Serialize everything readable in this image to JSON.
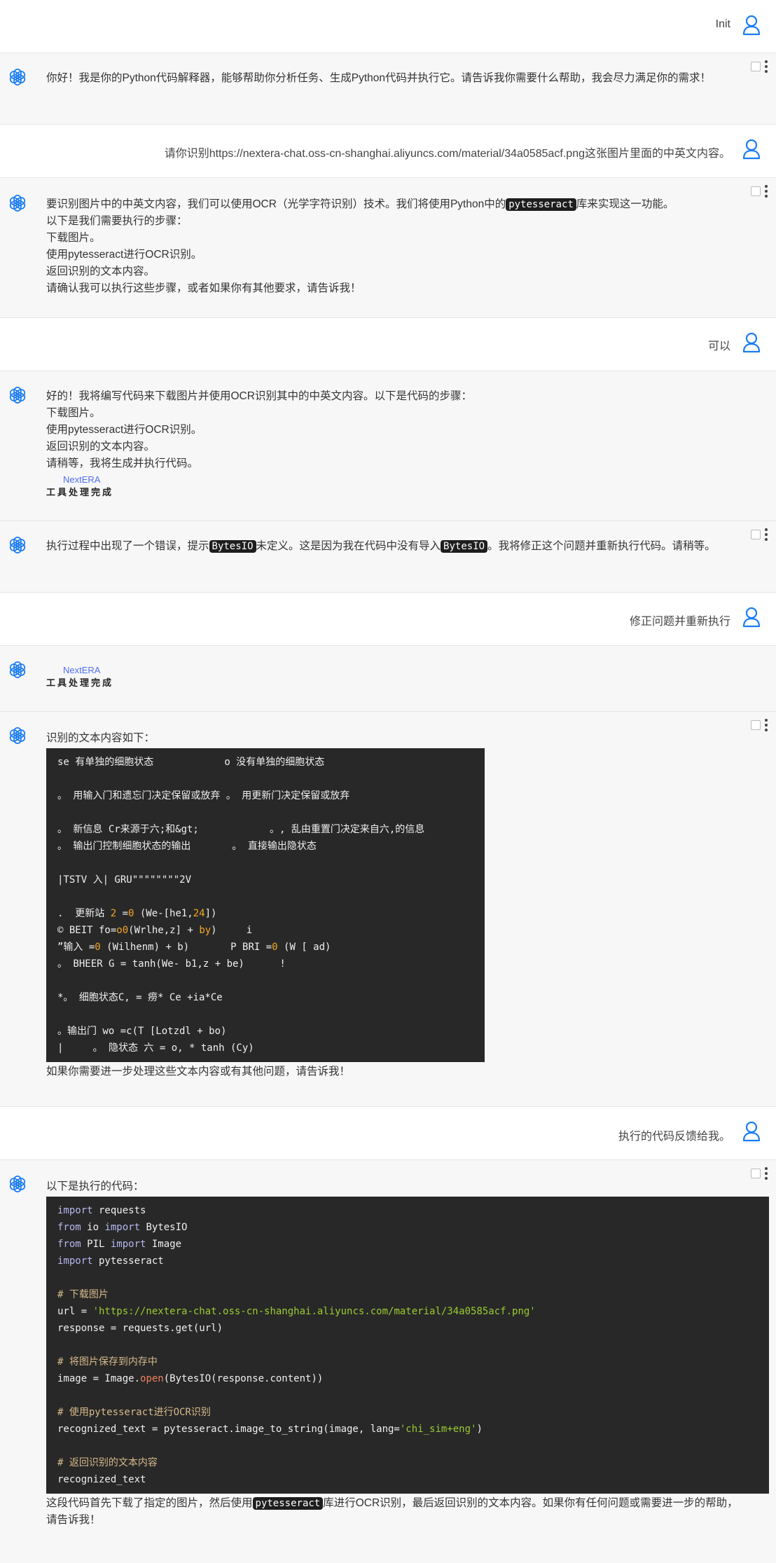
{
  "messages": {
    "m1_user": "Init",
    "m2_bot": "你好！我是你的Python代码解释器，能够帮助你分析任务、生成Python代码并执行它。请告诉我你需要什么帮助，我会尽力满足你的需求！",
    "m3_user": "请你识别https://nextera-chat.oss-cn-shanghai.aliyuncs.com/material/34a0585acf.png这张图片里面的中英文内容。",
    "m4_bot": {
      "line1_a": "要识别图片中的中英文内容，我们可以使用OCR（光学字符识别）技术。我们将使用Python中的",
      "line1_code": "pytesseract",
      "line1_b": "库来实现这一功能。",
      "line2": "以下是我们需要执行的步骤：",
      "line3": "下载图片。",
      "line4_code": "使用pytesseract进行OCR识别。",
      "line5": "返回识别的文本内容。",
      "line6": "请确认我可以执行这些步骤，或者如果你有其他要求，请告诉我！"
    },
    "m5_user": "可以",
    "m6_bot": {
      "line1": "好的！我将编写代码来下载图片并使用OCR识别其中的中英文内容。以下是代码的步骤：",
      "line2": "下载图片。",
      "line3": "使用pytesseract进行OCR识别。",
      "line4": "返回识别的文本内容。",
      "line5": "请稍等，我将生成并执行代码。",
      "brand": "NextERA",
      "status": "工具处理完成"
    },
    "m7_bot": {
      "a": "执行过程中出现了一个错误，提示",
      "code1": "BytesIO",
      "b": "未定义。这是因为我在代码中没有导入",
      "code2": "BytesIO",
      "c": "。我将修正这个问题并重新执行代码。请稍等。"
    },
    "m8_user": "修正问题并重新执行",
    "m9_bot": {
      "brand": "NextERA",
      "status": "工具处理完成"
    },
    "m10_bot": {
      "intro": "识别的文本内容如下：",
      "ocr_lines": [
        "se 有单独的细胞状态            o 没有单独的细胞状态",
        "",
        "。 用输入门和遗忘门决定保留或放弃 。 用更新门决定保留或放弃",
        "",
        "。 新信息 Cr来源于六;和&gt;            。, 乱由重置门决定来自六,的信息",
        "。 输出门控制细胞状态的输出       。 直接输出隐状态",
        "",
        "|TSTV 入| GRU\"\"\"\"\"\"\"\"2V",
        "",
        ".  更新站 2 =0 (We-[he1,24])",
        "© BEIT fo=o0(Wrlhe,z] + by)     i",
        "”输入 =0 (Wilhenm) + b)       P BRI =0 (W [ ad)",
        "。 BHEER G = tanh(We- b1,z + be)      !",
        "",
        "*。 细胞状态C, = 痨* Ce +ia*Ce",
        "",
        "。输出门 wo =c(T [Lotzdl + bo)",
        "|     。 隐状态 六 = o, * tanh (Cy)"
      ],
      "outro": "如果你需要进一步处理这些文本内容或有其他问题，请告诉我！"
    },
    "m11_user": "执行的代码反馈给我。",
    "m12_bot": {
      "intro": "以下是执行的代码：",
      "code_lines": [
        "import requests",
        "from io import BytesIO",
        "from PIL import Image",
        "import pytesseract",
        "",
        "# 下载图片",
        "url = 'https://nextera-chat.oss-cn-shanghai.aliyuncs.com/material/34a0585acf.png'",
        "response = requests.get(url)",
        "",
        "# 将图片保存到内存中",
        "image = Image.open(BytesIO(response.content))",
        "",
        "# 使用pytesseract进行OCR识别",
        "recognized_text = pytesseract.image_to_string(image, lang='chi_sim+eng')",
        "",
        "# 返回识别的文本内容",
        "recognized_text"
      ],
      "outro_a": "这段代码首先下载了指定的图片，然后使用",
      "outro_code": "pytesseract",
      "outro_b": "库进行OCR识别，最后返回识别的文本内容。如果你有任何问题或需要进一步的帮助，",
      "outro_c": "请告诉我！"
    }
  },
  "icons": {
    "user": "user-icon",
    "bot": "openai-logo-icon",
    "select": "checkbox-icon",
    "more": "more-vertical-icon"
  },
  "colors": {
    "accent": "#1a7cf4",
    "brand": "#4e6ef2",
    "code_bg": "#282828"
  }
}
